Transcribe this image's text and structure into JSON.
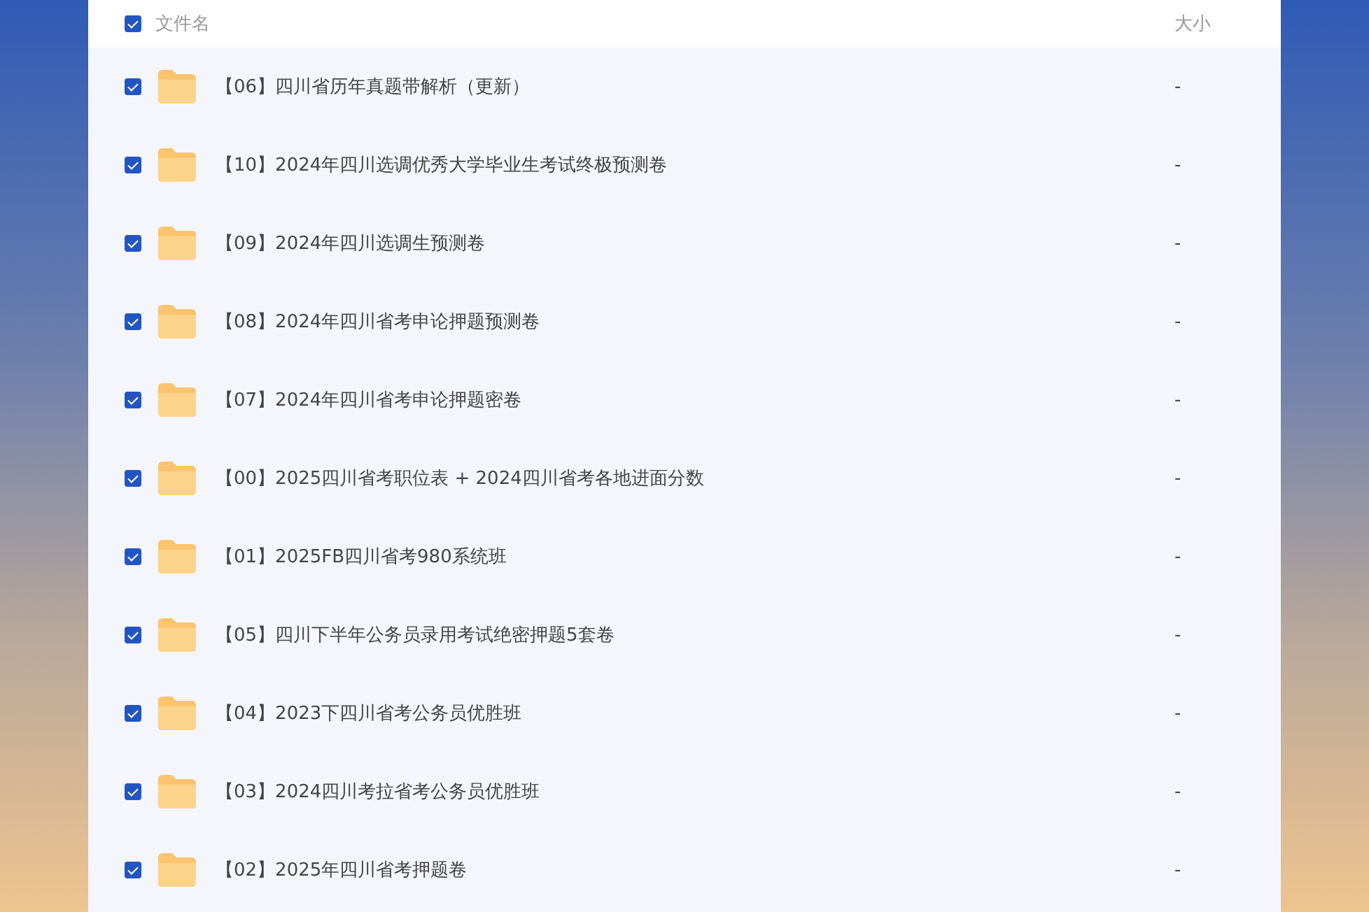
{
  "header": {
    "checked": true,
    "name_label": "文件名",
    "size_label": "大小"
  },
  "files": [
    {
      "name": "【06】四川省历年真题带解析（更新）",
      "size": "-",
      "checked": true
    },
    {
      "name": "【10】2024年四川选调优秀大学毕业生考试终极预测卷",
      "size": "-",
      "checked": true
    },
    {
      "name": "【09】2024年四川选调生预测卷",
      "size": "-",
      "checked": true
    },
    {
      "name": "【08】2024年四川省考申论押题预测卷",
      "size": "-",
      "checked": true
    },
    {
      "name": "【07】2024年四川省考申论押题密卷",
      "size": "-",
      "checked": true
    },
    {
      "name": "【00】2025四川省考职位表 + 2024四川省考各地进面分数",
      "size": "-",
      "checked": true
    },
    {
      "name": "【01】2025FB四川省考980系统班",
      "size": "-",
      "checked": true
    },
    {
      "name": "【05】四川下半年公务员录用考试绝密押题5套卷",
      "size": "-",
      "checked": true
    },
    {
      "name": "【04】2023下四川省考公务员优胜班",
      "size": "-",
      "checked": true
    },
    {
      "name": "【03】2024四川考拉省考公务员优胜班",
      "size": "-",
      "checked": true
    },
    {
      "name": "【02】2025年四川省考押题卷",
      "size": "-",
      "checked": true
    }
  ]
}
